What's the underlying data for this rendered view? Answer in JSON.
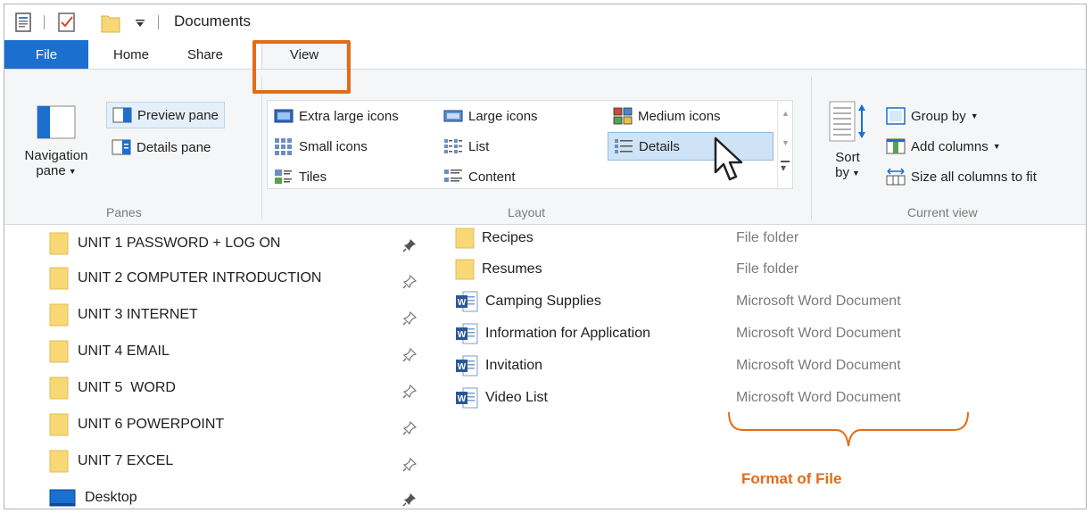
{
  "window": {
    "title": "Documents"
  },
  "tabs": [
    {
      "label": "File"
    },
    {
      "label": "Home"
    },
    {
      "label": "Share"
    },
    {
      "label": "View"
    }
  ],
  "ribbon": {
    "panes": {
      "group_label": "Panes",
      "navigation_pane_line1": "Navigation",
      "navigation_pane_line2": "pane",
      "preview_pane": "Preview pane",
      "details_pane": "Details pane"
    },
    "layout": {
      "group_label": "Layout",
      "items": {
        "extra_large_icons": "Extra large icons",
        "large_icons": "Large icons",
        "medium_icons": "Medium icons",
        "small_icons": "Small icons",
        "list": "List",
        "details": "Details",
        "tiles": "Tiles",
        "content": "Content"
      },
      "selected": "Details"
    },
    "current_view": {
      "group_label": "Current view",
      "sort_by_line1": "Sort",
      "sort_by_line2": "by",
      "group_by": "Group by",
      "add_columns": "Add columns",
      "size_all_columns": "Size all columns to fit"
    }
  },
  "nav_pane": {
    "items": [
      {
        "label": "UNIT 1 PASSWORD + LOG ON",
        "icon": "folder-icon"
      },
      {
        "label": "UNIT 2 COMPUTER INTRODUCTION",
        "icon": "folder-icon"
      },
      {
        "label": "UNIT 3 INTERNET",
        "icon": "folder-icon"
      },
      {
        "label": "UNIT 4 EMAIL",
        "icon": "folder-icon"
      },
      {
        "label": "UNIT 5  WORD",
        "icon": "folder-icon"
      },
      {
        "label": "UNIT 6 POWERPOINT",
        "icon": "folder-icon"
      },
      {
        "label": "UNIT 7 EXCEL",
        "icon": "folder-icon"
      },
      {
        "label": "Desktop",
        "icon": "desktop-icon"
      }
    ]
  },
  "files": [
    {
      "name": "Recipes",
      "type": "File folder",
      "icon": "folder-icon"
    },
    {
      "name": "Resumes",
      "type": "File folder",
      "icon": "folder-icon"
    },
    {
      "name": "Camping Supplies",
      "type": "Microsoft Word Document",
      "icon": "word-doc-icon"
    },
    {
      "name": "Information for Application",
      "type": "Microsoft Word Document",
      "icon": "word-doc-icon"
    },
    {
      "name": "Invitation",
      "type": "Microsoft Word Document",
      "icon": "word-doc-icon"
    },
    {
      "name": "Video List",
      "type": "Microsoft Word Document",
      "icon": "word-doc-icon"
    }
  ],
  "annotation": {
    "text": "Format of File"
  },
  "colors": {
    "accent": "#e46c17",
    "file_tab": "#1a6fcf",
    "selection": "#cfe3f7",
    "folder": "#f8d775"
  }
}
